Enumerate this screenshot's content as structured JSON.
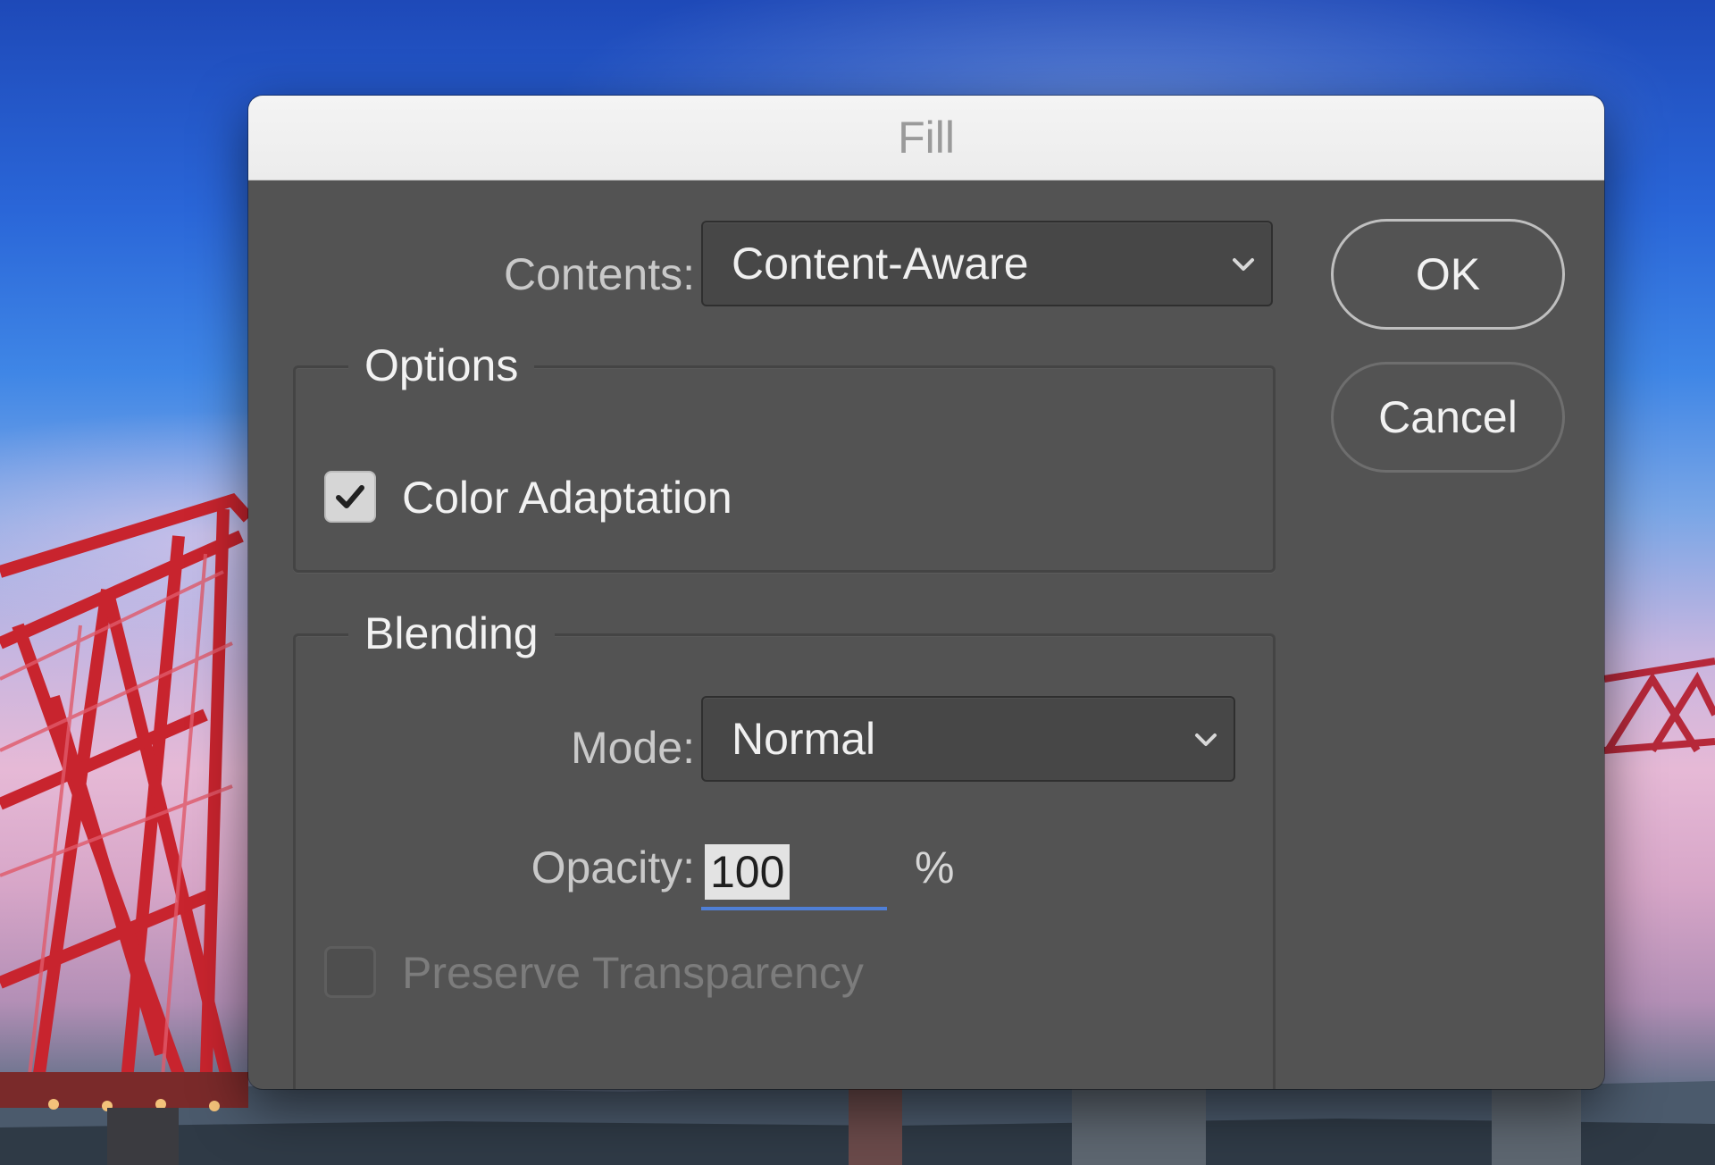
{
  "dialog": {
    "title": "Fill",
    "contents": {
      "label": "Contents:",
      "selected": "Content-Aware"
    },
    "options": {
      "title": "Options",
      "color_adaptation": {
        "label": "Color Adaptation",
        "checked": true
      }
    },
    "blending": {
      "title": "Blending",
      "mode": {
        "label": "Mode:",
        "selected": "Normal"
      },
      "opacity": {
        "label": "Opacity:",
        "value": "100",
        "unit": "%"
      },
      "preserve_transparency": {
        "label": "Preserve Transparency",
        "checked": false,
        "disabled": true
      }
    },
    "buttons": {
      "ok": "OK",
      "cancel": "Cancel"
    }
  },
  "colors": {
    "dialog_bg": "#535353",
    "titlebar_bg": "#efefef",
    "focus_accent": "#4f7fd6"
  }
}
